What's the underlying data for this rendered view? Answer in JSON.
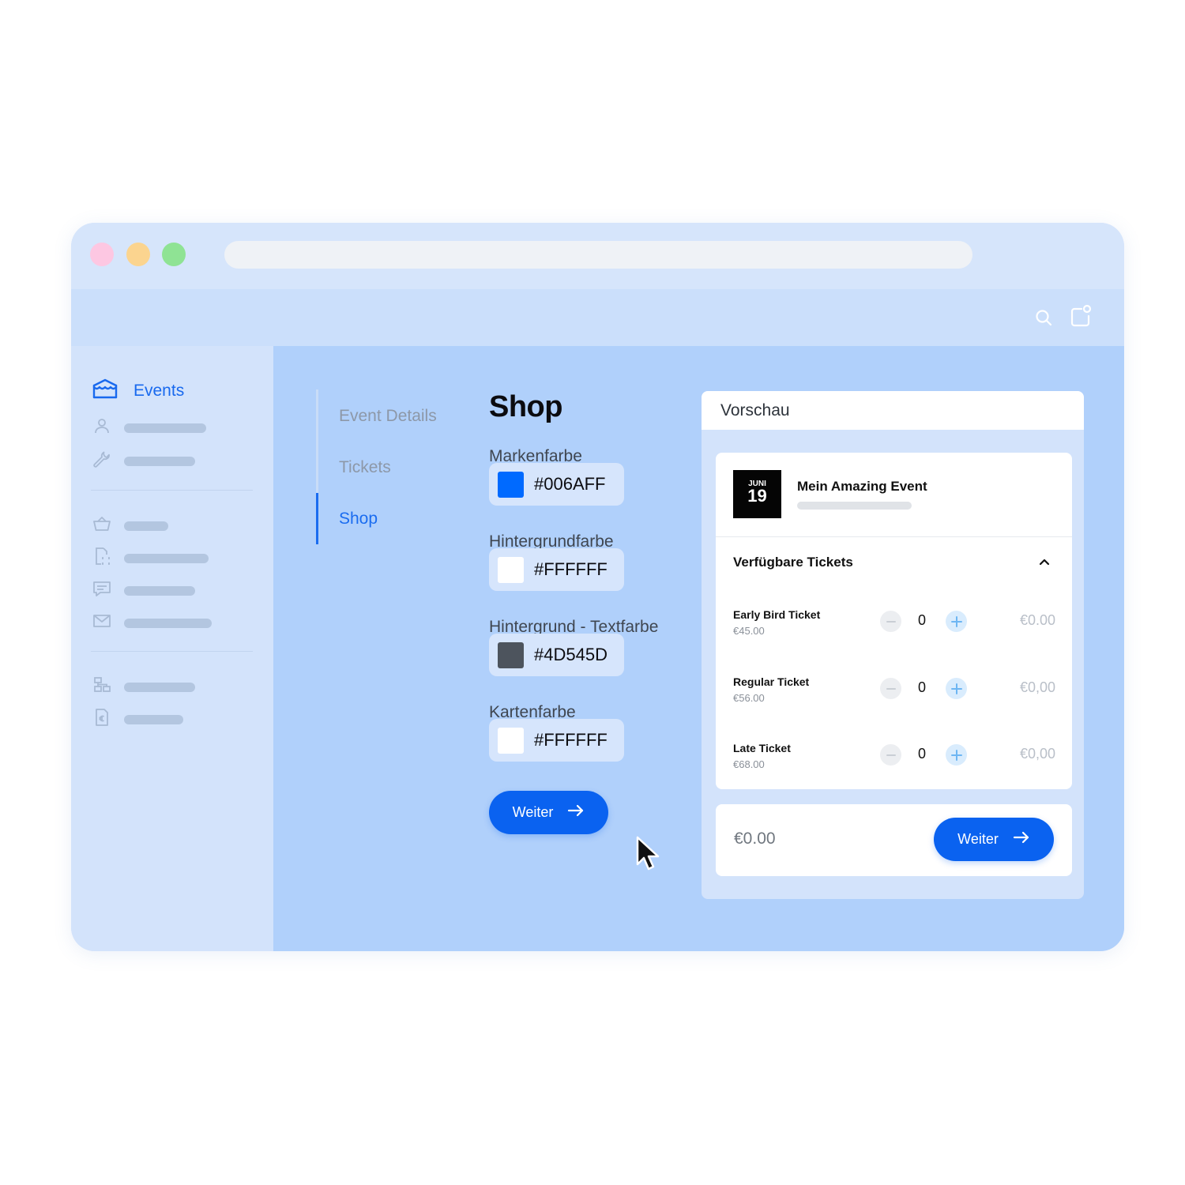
{
  "browser": {
    "traffic_lights": [
      "close",
      "minimize",
      "maximize"
    ]
  },
  "appbar": {
    "icons": [
      "search-icon",
      "notifications-icon"
    ]
  },
  "sidebar": {
    "active_item": {
      "label": "Events",
      "icon": "events-icon"
    },
    "items": [
      {
        "icon": "user-icon"
      },
      {
        "icon": "wrench-icon"
      },
      {
        "icon": "basket-icon"
      },
      {
        "icon": "scan-document-icon"
      },
      {
        "icon": "message-icon"
      },
      {
        "icon": "mail-icon"
      },
      {
        "icon": "layout-icon"
      },
      {
        "icon": "invoice-euro-icon"
      }
    ]
  },
  "steps": [
    {
      "label": "Event Details",
      "active": false
    },
    {
      "label": "Tickets",
      "active": false
    },
    {
      "label": "Shop",
      "active": true
    }
  ],
  "shop": {
    "title": "Shop",
    "fields": [
      {
        "label": "Markenfarbe",
        "value": "#006AFF",
        "swatch": "#006AFF"
      },
      {
        "label": "Hintergrundfarbe",
        "value": "#FFFFFF",
        "swatch": "#FFFFFF"
      },
      {
        "label": "Hintergrund - Textfarbe",
        "value": "#4D545D",
        "swatch": "#4D545D"
      },
      {
        "label": "Kartenfarbe",
        "value": "#FFFFFF",
        "swatch": "#FFFFFF"
      }
    ],
    "next_label": "Weiter"
  },
  "preview": {
    "title": "Vorschau",
    "event": {
      "month": "JUNI",
      "day": "19",
      "name": "Mein Amazing Event"
    },
    "tickets_heading": "Verfügbare Tickets",
    "tickets": [
      {
        "name": "Early Bird Ticket",
        "price": "€45.00",
        "quantity": "0",
        "total": "€0.00"
      },
      {
        "name": "Regular Ticket",
        "price": "€56.00",
        "quantity": "0",
        "total": "€0,00"
      },
      {
        "name": "Late Ticket",
        "price": "€68.00",
        "quantity": "0",
        "total": "€0,00"
      }
    ],
    "order_total": "€0.00",
    "next_label": "Weiter"
  },
  "colors": {
    "accent": "#0A62F0",
    "main_bg": "#B0D0FB",
    "sidebar_bg": "#D3E3FB"
  }
}
